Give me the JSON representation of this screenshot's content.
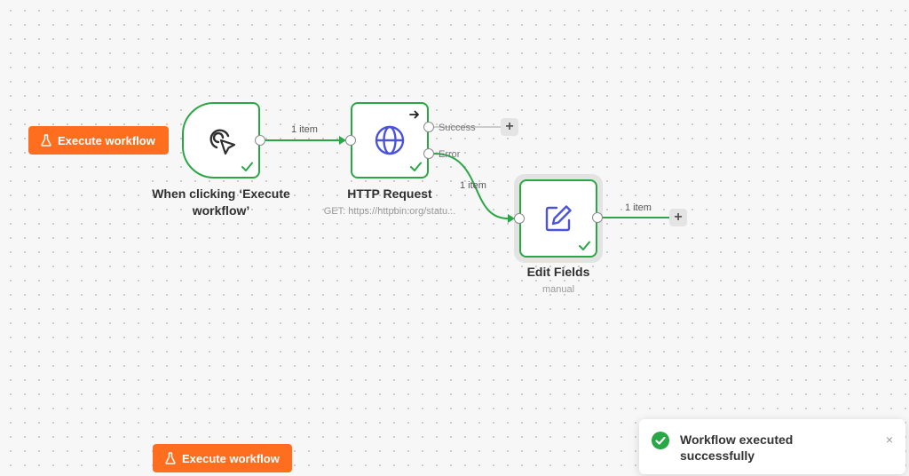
{
  "buttons": {
    "execute_top": "Execute workflow",
    "execute_bottom": "Execute workflow"
  },
  "nodes": {
    "trigger": {
      "title_line1": "When clicking ‘Execute",
      "title_line2": "workflow’",
      "icon": "cursor-click-icon",
      "status": "success"
    },
    "http": {
      "title": "HTTP Request",
      "subtitle": "GET: https://httpbin.org/statu...",
      "icon": "globe-icon",
      "status": "success",
      "outputs": [
        "Success",
        "Error"
      ]
    },
    "edit": {
      "title": "Edit Fields",
      "subtitle": "manual",
      "icon": "pencil-square-icon",
      "status": "success"
    }
  },
  "edges": {
    "trigger_to_http": "1 item",
    "http_error_to_edit": "1 item",
    "edit_out": "1 item"
  },
  "toast": {
    "message": "Workflow executed successfully",
    "close": "×"
  },
  "colors": {
    "accent": "#ff6d1f",
    "success": "#29a744",
    "icon_blue": "#4b53d9"
  }
}
